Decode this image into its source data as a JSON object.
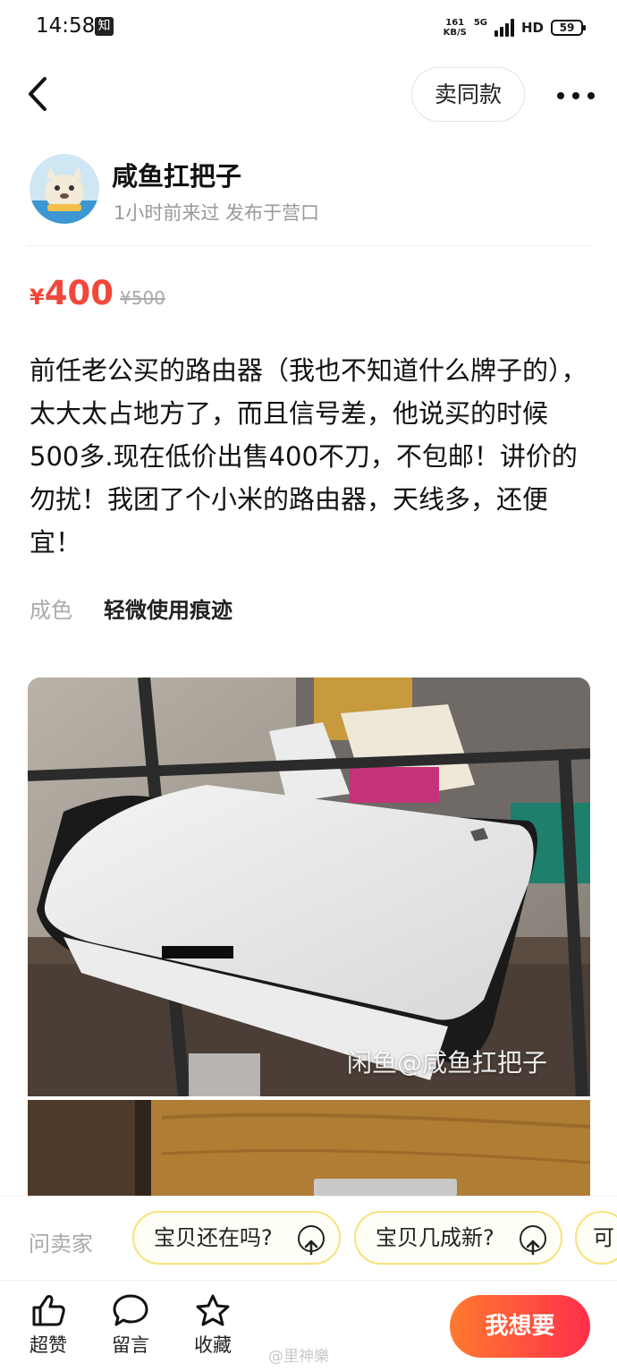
{
  "status_bar": {
    "time": "14:58",
    "app_icon_char": "知",
    "net_speed_value": "161",
    "net_speed_unit": "KB/S",
    "network_type": "5G",
    "hd_label": "HD",
    "battery_level": "59"
  },
  "header": {
    "sell_same_label": "卖同款"
  },
  "seller": {
    "name": "咸鱼扛把子",
    "meta": "1小时前来过 发布于营口"
  },
  "price": {
    "currency": "¥",
    "current": "400",
    "original": "¥500"
  },
  "description": "前任老公买的路由器（我也不知道什么牌子的），太大太占地方了，而且信号差，他说买的时候500多.现在低价出售400不刀，不包邮！讲价的勿扰！我团了个小米的路由器，天线多，还便宜！",
  "condition": {
    "label": "成色",
    "value": "轻微使用痕迹"
  },
  "photo": {
    "watermark": "闲鱼@咸鱼扛把子"
  },
  "ask_bar": {
    "label": "问卖家",
    "chips": [
      "宝贝还在吗?",
      "宝贝几成新?",
      "可"
    ]
  },
  "bottom_bar": {
    "like_label": "超赞",
    "comment_label": "留言",
    "favorite_label": "收藏",
    "want_label": "我想要",
    "weibo_watermark": "@里神樂"
  },
  "colors": {
    "price_red": "#f0473a",
    "want_gradient_start": "#ff7a2e",
    "want_gradient_end": "#ff2f4a",
    "chip_border": "#f6e27a"
  }
}
